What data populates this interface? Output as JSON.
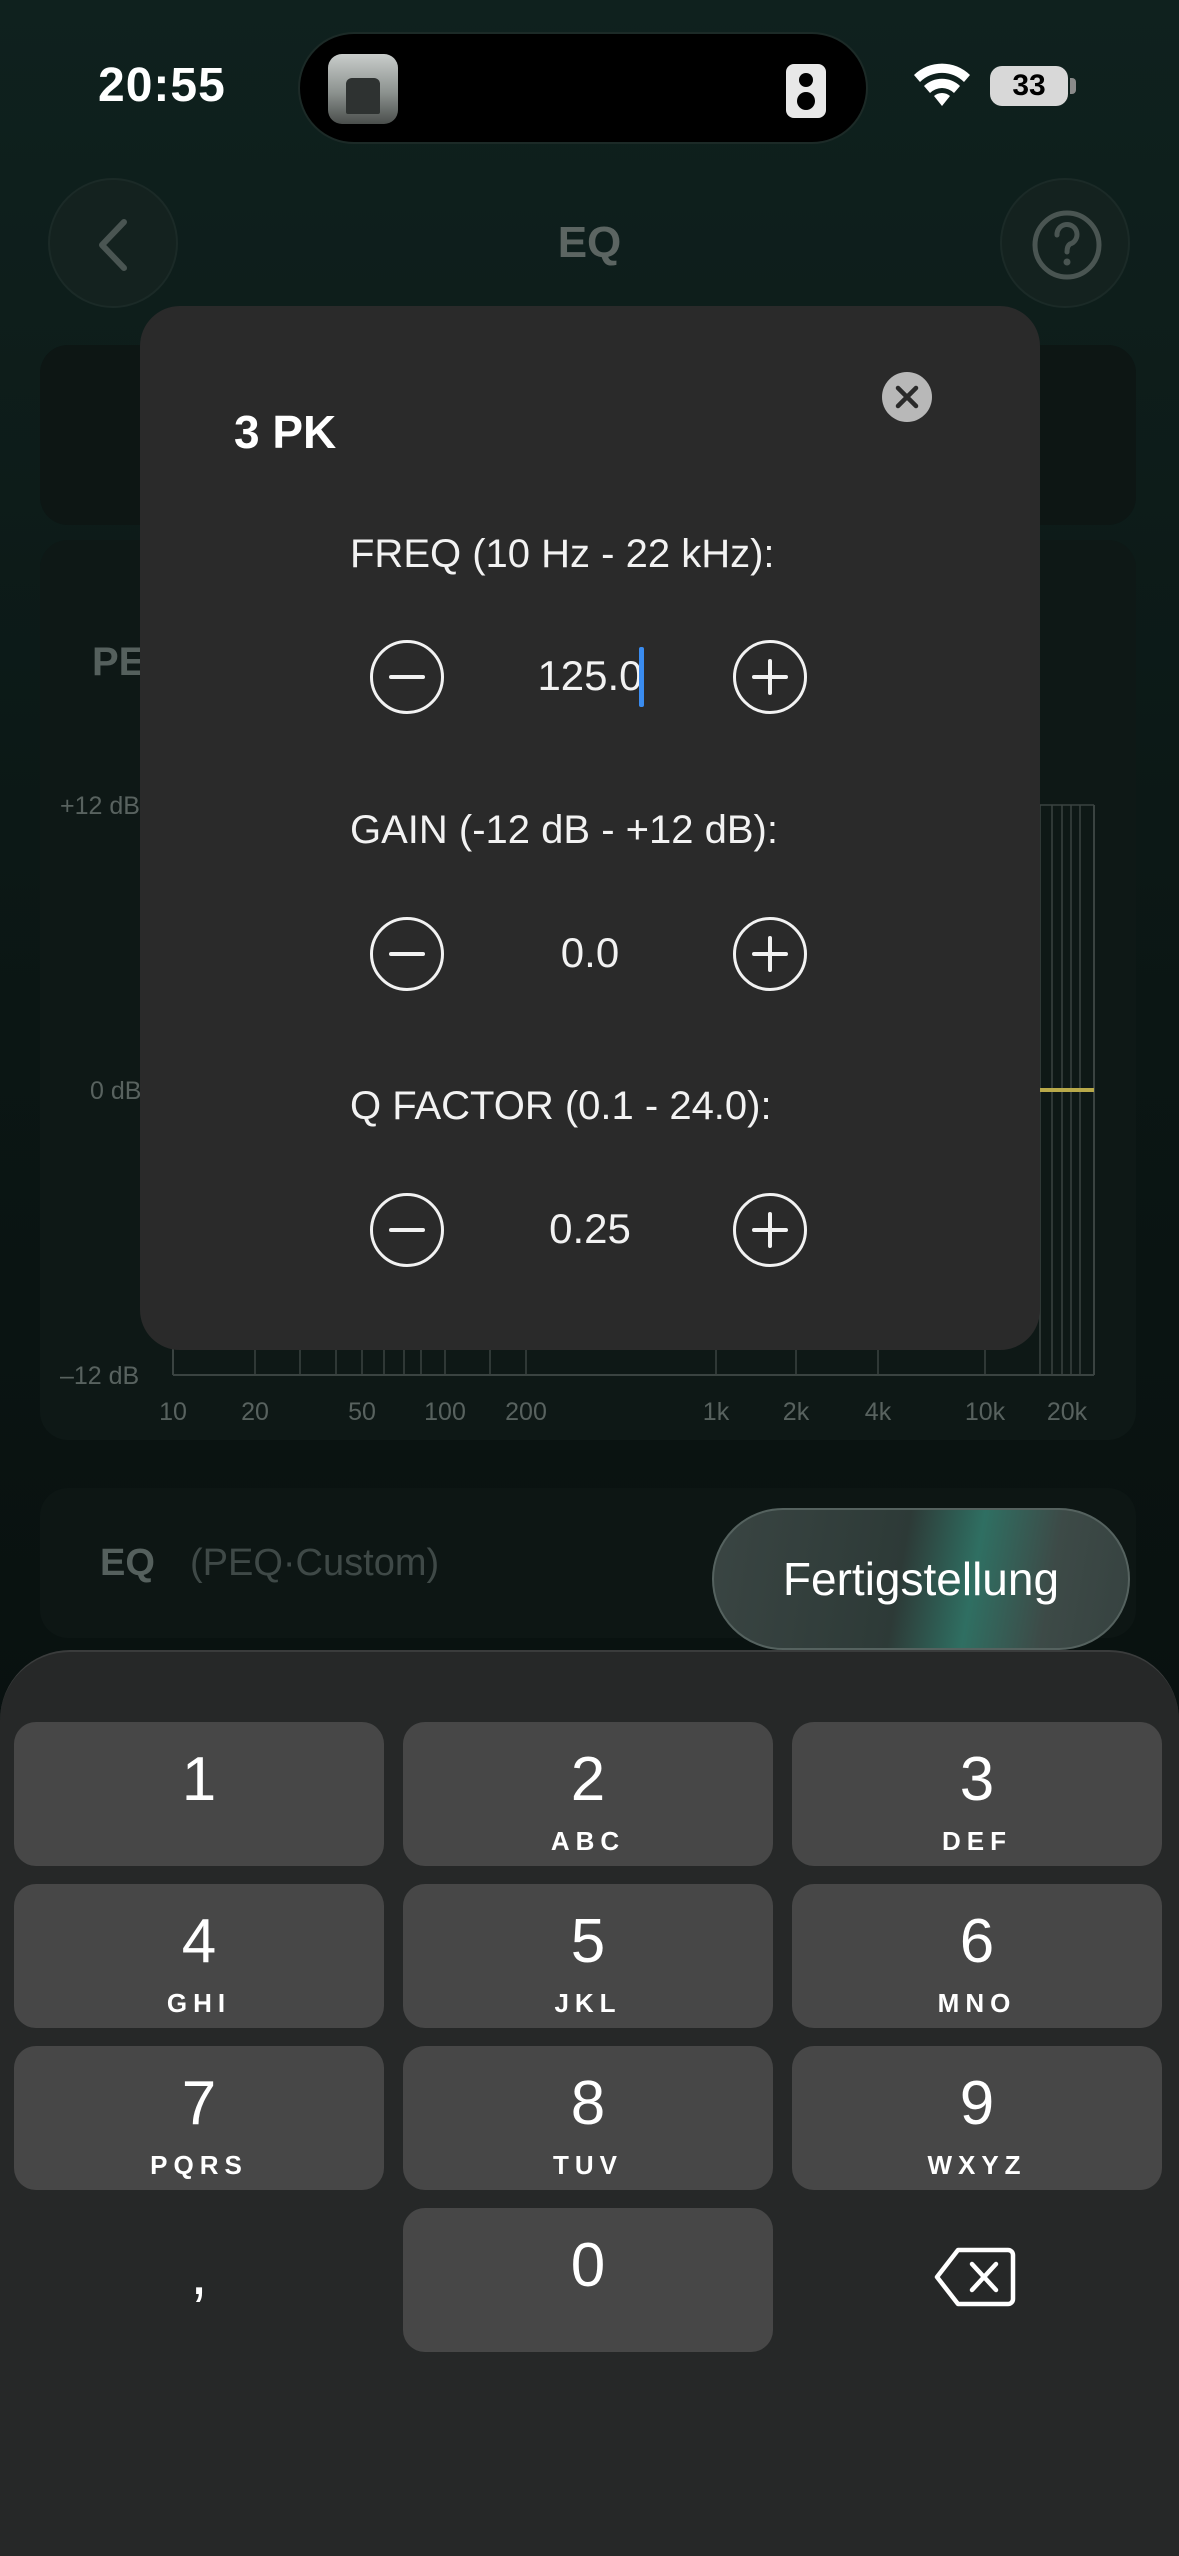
{
  "status_bar": {
    "time": "20:55",
    "battery": "33"
  },
  "nav": {
    "title": "EQ"
  },
  "background": {
    "peq_label": "PE",
    "y_top": "+12 dB",
    "y_mid": "0 dB",
    "y_bottom": "–12 dB",
    "x_ticks": [
      "10",
      "20",
      "50",
      "100",
      "200",
      "1k",
      "2k",
      "4k",
      "10k",
      "20k"
    ],
    "eq_label": "EQ",
    "eq_sub": "(PEQ·Custom)"
  },
  "modal": {
    "title": "3 PK",
    "freq_label": "FREQ (10 Hz - 22 kHz):",
    "freq_value": "125.0",
    "gain_label": "GAIN (-12 dB - +12 dB):",
    "gain_value": "0.0",
    "q_label": "Q FACTOR (0.1 - 24.0):",
    "q_value": "0.25"
  },
  "done_button": "Fertigstellung",
  "keyboard": {
    "keys": [
      {
        "num": "1",
        "letters": ""
      },
      {
        "num": "2",
        "letters": "ABC"
      },
      {
        "num": "3",
        "letters": "DEF"
      },
      {
        "num": "4",
        "letters": "GHI"
      },
      {
        "num": "5",
        "letters": "JKL"
      },
      {
        "num": "6",
        "letters": "MNO"
      },
      {
        "num": "7",
        "letters": "PQRS"
      },
      {
        "num": "8",
        "letters": "TUV"
      },
      {
        "num": "9",
        "letters": "WXYZ"
      },
      {
        "num": "0",
        "letters": ""
      }
    ],
    "comma": ","
  },
  "colors": {
    "accent_caret": "#3a8cf0",
    "eq_curve": "#b8a94a"
  }
}
